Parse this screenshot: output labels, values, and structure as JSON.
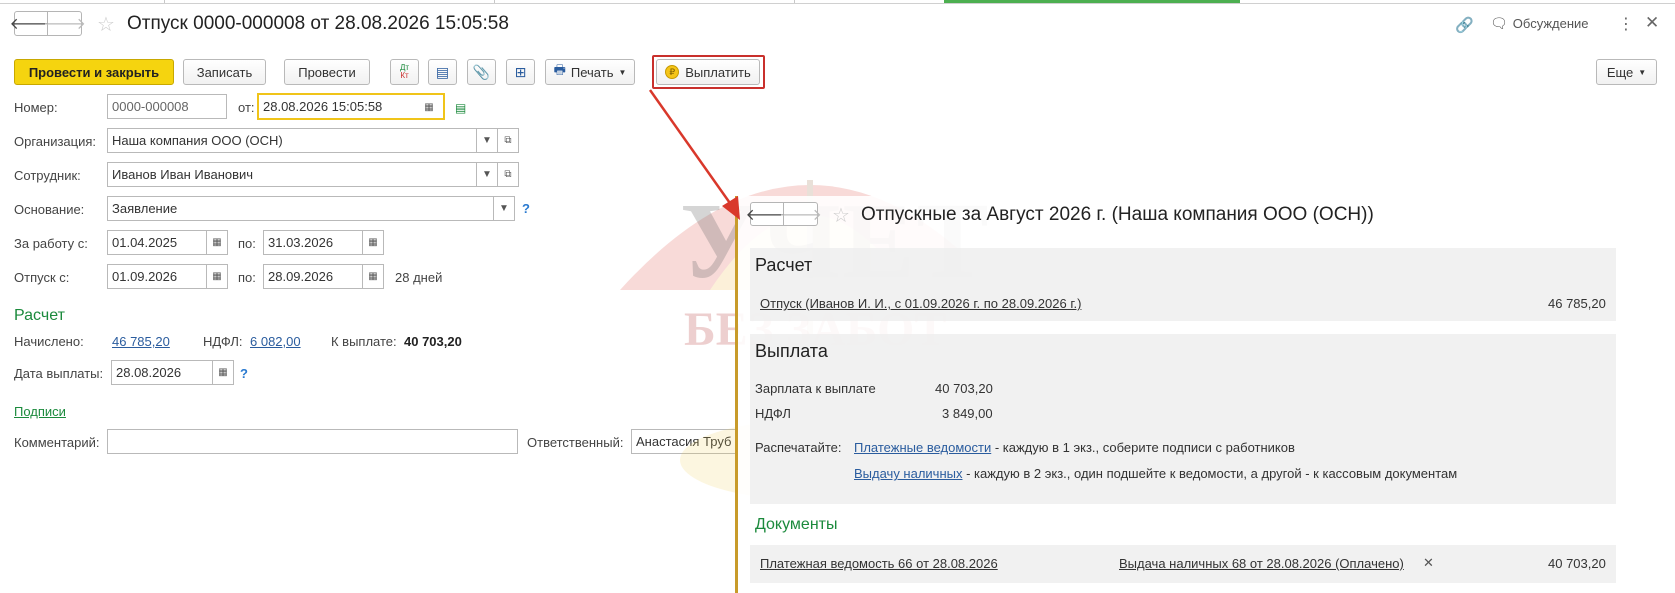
{
  "window": {
    "title": "Отпуск 0000-000008 от 28.08.2026 15:05:58",
    "discuss_label": "Обсуждение"
  },
  "toolbar": {
    "post_close": "Провести и закрыть",
    "save": "Записать",
    "post": "Провести",
    "dtkt_top": "Дт",
    "dtkt_bottom": "Кт",
    "print": "Печать",
    "pay": "Выплатить",
    "more": "Еще"
  },
  "form": {
    "number_label": "Номер:",
    "number_value": "0000-000008",
    "from_label": "от:",
    "date_value": "28.08.2026 15:05:58",
    "org_label": "Организация:",
    "org_value": "Наша компания ООО (ОСН)",
    "employee_label": "Сотрудник:",
    "employee_value": "Иванов Иван Иванович",
    "basis_label": "Основание:",
    "basis_value": "Заявление",
    "work_label": "За работу с:",
    "work_from": "01.04.2025",
    "to_label": "по:",
    "work_to": "31.03.2026",
    "vacation_label": "Отпуск с:",
    "vacation_from": "01.09.2026",
    "vacation_to": "28.09.2026",
    "days": "28 дней",
    "calc_header": "Расчет",
    "accrued_label": "Начислено:",
    "accrued_value": "46 785,20",
    "ndfl_label": "НДФЛ:",
    "ndfl_value": "6 082,00",
    "topay_label": "К выплате:",
    "topay_value": "40 703,20",
    "paydate_label": "Дата выплаты:",
    "paydate_value": "28.08.2026",
    "signatures": "Подписи",
    "comment_label": "Комментарий:",
    "responsible_label": "Ответственный:",
    "responsible_value": "Анастасия Труб"
  },
  "popup": {
    "title": "Отпускные за Август 2026 г. (Наша компания ООО (ОСН))",
    "calc_header": "Расчет",
    "calc_link": "Отпуск (Иванов И. И., с 01.09.2026 г. по 28.09.2026 г.)",
    "calc_amount": "46 785,20",
    "pay_header": "Выплата",
    "salary_label": "Зарплата к выплате",
    "salary_value": "40 703,20",
    "ndfl_label": "НДФЛ",
    "ndfl_value": "3 849,00",
    "print_label": "Распечатайте:",
    "print_link1": "Платежные ведомости",
    "print_text1": " - каждую в 1 экз., соберите подписи с работников",
    "print_link2": "Выдачу наличных",
    "print_text2": " - каждую в 2 экз., один подшейте к ведомости, а другой - к кассовым документам",
    "docs_header": "Документы",
    "doc1": "Платежная ведомость 66 от 28.08.2026",
    "doc2": "Выдача наличных 68 от 28.08.2026 (Оплачено)",
    "doc_amount": "40 703,20"
  },
  "watermark": {
    "line1": "УЧЕТ",
    "line2": "БЕЗ ЗАБОТ"
  },
  "colors": {
    "accent_yellow": "#f5d40f",
    "green_header": "#1b8a3c",
    "link_blue": "#2a5c9e",
    "highlight_red": "#c9302c"
  }
}
